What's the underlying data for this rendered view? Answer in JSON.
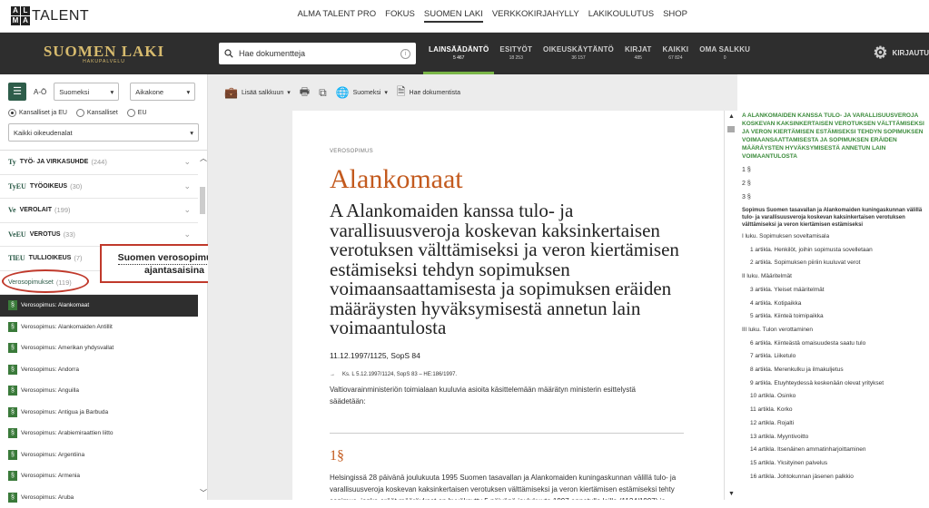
{
  "topbar": {
    "logo_mark": [
      "A",
      "L",
      "M",
      "A"
    ],
    "logo_text": "TALENT",
    "nav": [
      "ALMA TALENT PRO",
      "FOKUS",
      "SUOMEN LAKI",
      "VERKKOKIRJAHYLLY",
      "LAKIKOULUTUS",
      "SHOP"
    ],
    "active_nav": "SUOMEN LAKI"
  },
  "header": {
    "brand": "SUOMEN LAKI",
    "brand_sub": "HAKUPALVELU",
    "search_placeholder": "Hae dokumentteja",
    "tabs": [
      {
        "label": "LAINSÄÄDÄNTÖ",
        "count": "5 467",
        "active": true
      },
      {
        "label": "ESITYÖT",
        "count": "18 253"
      },
      {
        "label": "OIKEUSKÄYTÄNTÖ",
        "count": "36 157"
      },
      {
        "label": "KIRJAT",
        "count": "485"
      },
      {
        "label": "KAIKKI",
        "count": "67 824"
      },
      {
        "label": "OMA SALKKU",
        "count": "0"
      }
    ],
    "login": "KIRJAUTU"
  },
  "sidebar": {
    "ao": "A-Ö",
    "lang": "Suomeksi",
    "sort": "Aikakone",
    "radios": [
      {
        "label": "Kansalliset ja EU",
        "checked": true
      },
      {
        "label": "Kansalliset",
        "checked": false
      },
      {
        "label": "EU",
        "checked": false
      }
    ],
    "scope": "Kaikki oikeudenalat",
    "categories": [
      {
        "abbr": "Ty",
        "name": "TYÖ- JA VIRKASUHDE",
        "count": "(244)"
      },
      {
        "abbr": "TyEU",
        "name": "TYÖOIKEUS",
        "count": "(30)"
      },
      {
        "abbr": "Ve",
        "name": "VEROLAIT",
        "count": "(199)"
      },
      {
        "abbr": "VeEU",
        "name": "VEROTUS",
        "count": "(33)"
      },
      {
        "abbr": "TlEU",
        "name": "TULLIOIKEUS",
        "count": "(7)"
      }
    ],
    "subcategory": {
      "name": "Verosopimukset",
      "count": "(119)"
    },
    "docs": [
      "Verosopimus: Alankomaat",
      "Verosopimus: Alankomaiden Antillit",
      "Verosopimus: Amerikan yhdysvallat",
      "Verosopimus: Andorra",
      "Verosopimus: Anguilla",
      "Verosopimus: Antigua ja Barbuda",
      "Verosopimus: Arabiemiraattien liitto",
      "Verosopimus: Argentiina",
      "Verosopimus: Armenia",
      "Verosopimus: Aruba"
    ],
    "active_doc": 0
  },
  "callout": {
    "line1": "Suomen verosopimukset",
    "line2": "ajantasaisina"
  },
  "toolbar": {
    "add": "Lisää salkkuun",
    "lang": "Suomeksi",
    "search": "Hae dokumentista"
  },
  "document": {
    "kind": "VEROSOPIMUS",
    "country": "Alankomaat",
    "title": "A Alankomaiden kanssa tulo- ja varallisuusveroja koskevan kaksinkertaisen verotuksen välttämiseksi ja veron kiertämisen estämiseksi tehdyn sopimuksen voimaansaattamisesta ja sopimuksen eräiden määräysten hyväksymisestä annetun lain voimaantulosta",
    "ref": "11.12.1997/1125, SopS 84",
    "note": "Ks. L 5.12.1997/1124, SopS 83 – HE:186/1997.",
    "ministry": "Valtiovarainministeriön toimialaan kuuluvia asioita käsittelemään määrätyn ministerin esittelystä säädetään:",
    "section": "1§",
    "body": "Helsingissä 28 päivänä joulukuuta 1995 Suomen tasavallan ja Alankomaiden kuningaskunnan välillä tulo- ja varallisuusveroja koskevan kaksinkertaisen verotuksen välttämiseksi ja veron kiertämisen estämiseksi tehty sopimus, jonka eräät määräykset on hyväksytty 5 päivänä joulukuuta 1997 annetulla lailla (1124/1997) ja"
  },
  "toc": {
    "title": "A ALANKOMAIDEN KANSSA TULO- JA VARALLISUUSVEROJA KOSKEVAN KAKSINKERTAISEN VEROTUKSEN VÄLTTÄMISEKSI JA VERON KIERTÄMISEN ESTÄMISEKSI TEHDYN SOPIMUKSEN VOIMAANSAATTAMISESTA JA SOPIMUKSEN ERÄIDEN MÄÄRÄYSTEN HYVÄKSYMISESTÄ ANNETUN LAIN VOIMAANTULOSTA",
    "sections": [
      "1 §",
      "2 §",
      "3 §"
    ],
    "subtitle": "Sopimus Suomen tasavallan ja Alankomaiden kuningaskunnan välillä tulo- ja varallisuusveroja koskevan kaksinkertaisen verotuksen välttämiseksi ja veron kiertämisen estämiseksi",
    "items": [
      {
        "t": "I luku. Sopimuksen soveltamisala",
        "l": 1
      },
      {
        "t": "1 artikla. Henkilöt, joihin sopimusta sovelletaan",
        "l": 2
      },
      {
        "t": "2 artikla. Sopimuksen piiriin kuuluvat verot",
        "l": 2
      },
      {
        "t": "II luku. Määritelmät",
        "l": 1
      },
      {
        "t": "3 artikla. Yleiset määritelmät",
        "l": 2
      },
      {
        "t": "4 artikla. Kotipaikka",
        "l": 2
      },
      {
        "t": "5 artikla. Kiinteä toimipaikka",
        "l": 2
      },
      {
        "t": "III luku. Tulon verottaminen",
        "l": 1
      },
      {
        "t": "6 artikla. Kiinteästä omaisuudesta saatu tulo",
        "l": 2
      },
      {
        "t": "7 artikla. Liiketulo",
        "l": 2
      },
      {
        "t": "8 artikla. Merenkulku ja ilmakuljetus",
        "l": 2
      },
      {
        "t": "9 artikla. Etuyhteydessä keskenään olevat yritykset",
        "l": 2
      },
      {
        "t": "10 artikla. Osinko",
        "l": 2
      },
      {
        "t": "11 artikla. Korko",
        "l": 2
      },
      {
        "t": "12 artikla. Rojalti",
        "l": 2
      },
      {
        "t": "13 artikla. Myyntivoitto",
        "l": 2
      },
      {
        "t": "14 artikla. Itsenäinen ammatinharjoittaminen",
        "l": 2
      },
      {
        "t": "15 artikla. Yksityinen palvelus",
        "l": 2
      },
      {
        "t": "16 artikla. Johtokunnan jäsenen palkkio",
        "l": 2
      }
    ]
  },
  "colors": {
    "accent_green": "#7ab648",
    "doc_orange": "#c35a1e",
    "callout_red": "#c0392b",
    "header_dark": "#2e2e2e"
  }
}
